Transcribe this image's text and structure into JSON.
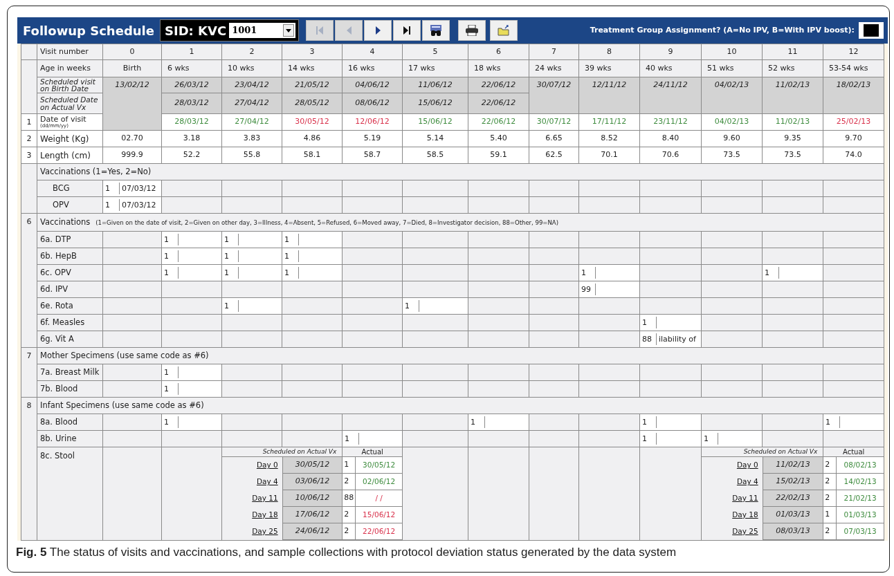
{
  "header": {
    "title": "Followup Schedule",
    "sid_label": "SID: KVC",
    "sid_value": "1001",
    "treatment_label": "Treatment Group Assignment? (A=No IPV, B=With IPV boost):"
  },
  "nav_buttons": [
    {
      "kind": "first",
      "disabled": true
    },
    {
      "kind": "prev",
      "disabled": true
    },
    {
      "kind": "next",
      "disabled": false
    },
    {
      "kind": "last",
      "disabled": false
    },
    {
      "kind": "find",
      "disabled": false
    },
    {
      "kind": "print",
      "disabled": false
    },
    {
      "kind": "open",
      "disabled": false
    }
  ],
  "row_labels": {
    "visit_number": "Visit number",
    "age": "Age in weeks",
    "scheduled_birth": "Scheduled visit on Birth Date",
    "scheduled_actual": "Scheduled Date on Actual Vx",
    "date": {
      "number": "1",
      "label": "Date of visit",
      "hint": "(dd/mm/yy)"
    },
    "weight": {
      "number": "2",
      "label": "Weight (Kg)"
    },
    "length": {
      "number": "3",
      "label": "Length (cm)"
    }
  },
  "visits": [
    {
      "number": "0",
      "age": "Birth",
      "scheduled_birth": "13/02/12",
      "weight": "02.70",
      "length": "999.9"
    },
    {
      "number": "1",
      "age": "6 wks",
      "scheduled_birth": "26/03/12",
      "scheduled_actual": "28/03/12",
      "date": "28/03/12",
      "on_time": true,
      "weight": "3.18",
      "length": "52.2"
    },
    {
      "number": "2",
      "age": "10 wks",
      "scheduled_birth": "23/04/12",
      "scheduled_actual": "27/04/12",
      "date": "27/04/12",
      "on_time": true,
      "weight": "3.83",
      "length": "55.8"
    },
    {
      "number": "3",
      "age": "14 wks",
      "scheduled_birth": "21/05/12",
      "scheduled_actual": "28/05/12",
      "date": "30/05/12",
      "on_time": false,
      "weight": "4.86",
      "length": "58.1"
    },
    {
      "number": "4",
      "age": "16 wks",
      "scheduled_birth": "04/06/12",
      "scheduled_actual": "08/06/12",
      "date": "12/06/12",
      "on_time": false,
      "weight": "5.19",
      "length": "58.7"
    },
    {
      "number": "5",
      "age": "17 wks",
      "scheduled_birth": "11/06/12",
      "scheduled_actual": "15/06/12",
      "date": "15/06/12",
      "on_time": true,
      "weight": "5.14",
      "length": "58.5"
    },
    {
      "number": "6",
      "age": "18 wks",
      "scheduled_birth": "22/06/12",
      "scheduled_actual": "22/06/12",
      "date": "22/06/12",
      "on_time": true,
      "weight": "5.40",
      "length": "59.1"
    },
    {
      "number": "7",
      "age": "24 wks",
      "scheduled_birth": "30/07/12",
      "date": "30/07/12",
      "on_time": true,
      "weight": "6.65",
      "length": "62.5"
    },
    {
      "number": "8",
      "age": "39 wks",
      "scheduled_birth": "12/11/12",
      "date": "17/11/12",
      "on_time": true,
      "weight": "8.52",
      "length": "70.1"
    },
    {
      "number": "9",
      "age": "40 wks",
      "scheduled_birth": "24/11/12",
      "date": "23/11/12",
      "on_time": true,
      "weight": "8.40",
      "length": "70.6"
    },
    {
      "number": "10",
      "age": "51 wks",
      "scheduled_birth": "04/02/13",
      "date": "04/02/13",
      "on_time": true,
      "weight": "9.60",
      "length": "73.5"
    },
    {
      "number": "11",
      "age": "52 wks",
      "scheduled_birth": "11/02/13",
      "date": "11/02/13",
      "on_time": true,
      "weight": "9.35",
      "length": "73.5"
    },
    {
      "number": "12",
      "age": "53-54 wks",
      "scheduled_birth": "18/02/13",
      "date": "25/02/13",
      "on_time": false,
      "weight": "9.70",
      "length": "74.0"
    }
  ],
  "sections": [
    {
      "title": "Vaccinations (1=Yes, 2=No)",
      "rows": [
        {
          "kind": "entries",
          "label": "BCG",
          "cells": [
            {
              "code": "1",
              "note": "07/03/12"
            },
            {},
            {},
            {},
            {},
            {},
            {},
            {},
            {},
            {},
            {},
            {},
            {}
          ]
        },
        {
          "kind": "entries",
          "label": "OPV",
          "cells": [
            {
              "code": "1",
              "note": "07/03/12"
            },
            {},
            {},
            {},
            {},
            {},
            {},
            {},
            {},
            {},
            {},
            {},
            {}
          ]
        }
      ]
    },
    {
      "number": "6",
      "title": "Vaccinations",
      "legend": "(1=Given on the date of visit, 2=Given on other day, 3=Illness, 4=Absent, 5=Refused, 6=Moved away, 7=Died, 8=Investigator decision, 88=Other, 99=NA)",
      "rows": [
        {
          "kind": "entries",
          "label": "6a. DTP",
          "cells": [
            {},
            {
              "code": "1"
            },
            {
              "code": "1"
            },
            {
              "code": "1"
            },
            {},
            {},
            {},
            {},
            {},
            {},
            {},
            {},
            {}
          ]
        },
        {
          "kind": "entries",
          "label": "6b. HepB",
          "cells": [
            {},
            {
              "code": "1"
            },
            {
              "code": "1"
            },
            {
              "code": "1"
            },
            {},
            {},
            {},
            {},
            {},
            {},
            {},
            {},
            {}
          ]
        },
        {
          "kind": "entries",
          "label": "6c. OPV",
          "cells": [
            {},
            {
              "code": "1"
            },
            {
              "code": "1"
            },
            {
              "code": "1"
            },
            {},
            {},
            {},
            {},
            {
              "code": "1"
            },
            {},
            {},
            {
              "code": "1"
            },
            {}
          ]
        },
        {
          "kind": "entries",
          "label": "6d. IPV",
          "cells": [
            {},
            {},
            {},
            {},
            {},
            {},
            {},
            {},
            {
              "code": "99"
            },
            {},
            {},
            {},
            {}
          ]
        },
        {
          "kind": "entries",
          "label": "6e. Rota",
          "cells": [
            {},
            {},
            {
              "code": "1"
            },
            {},
            {},
            {
              "code": "1"
            },
            {},
            {},
            {},
            {},
            {},
            {},
            {}
          ]
        },
        {
          "kind": "entries",
          "label": "6f. Measles",
          "cells": [
            {},
            {},
            {},
            {},
            {},
            {},
            {},
            {},
            {},
            {
              "code": "1"
            },
            {},
            {},
            {}
          ]
        },
        {
          "kind": "entries",
          "label": "6g. Vit A",
          "cells": [
            {},
            {},
            {},
            {},
            {},
            {},
            {},
            {},
            {},
            {
              "code": "88",
              "note": "ilability of"
            },
            {},
            {},
            {}
          ]
        }
      ]
    },
    {
      "number": "7",
      "title": "Mother Specimens (use same code as #6)",
      "rows": [
        {
          "kind": "entries",
          "label": "7a. Breast Milk",
          "cells": [
            {},
            {
              "code": "1"
            },
            {},
            {},
            {},
            {},
            {},
            {},
            {},
            {},
            {},
            {},
            {}
          ]
        },
        {
          "kind": "entries",
          "label": "7b. Blood",
          "cells": [
            {},
            {
              "code": "1"
            },
            {},
            {},
            {},
            {},
            {},
            {},
            {},
            {},
            {},
            {},
            {}
          ]
        }
      ]
    },
    {
      "number": "8",
      "title": "Infant Specimens (use same code as #6)",
      "rows": [
        {
          "kind": "entries",
          "label": "8a. Blood",
          "cells": [
            {},
            {
              "code": "1"
            },
            {},
            {},
            {},
            {},
            {
              "code": "1"
            },
            {},
            {},
            {
              "code": "1"
            },
            {},
            {},
            {
              "code": "1"
            }
          ]
        },
        {
          "kind": "entries",
          "label": "8b. Urine",
          "cells": [
            {},
            {},
            {},
            {},
            {
              "code": "1"
            },
            {},
            {},
            {},
            {},
            {
              "code": "1"
            },
            {
              "code": "1"
            },
            {},
            {}
          ]
        },
        {
          "kind": "schedule",
          "label": "8c. Stool",
          "blocks": [
            {
              "kind": "empty"
            },
            {
              "kind": "empty"
            },
            {
              "kind": "schedule",
              "heading": "Scheduled on Actual Vx",
              "actual_heading": "Actual",
              "days": [
                {
                  "label": "Day 0",
                  "scheduled": "30/05/12",
                  "code": "1",
                  "actual": "30/05/12",
                  "on_time": true
                },
                {
                  "label": "Day 4",
                  "scheduled": "03/06/12",
                  "code": "2",
                  "actual": "02/06/12",
                  "on_time": true
                },
                {
                  "label": "Day 11",
                  "scheduled": "10/06/12",
                  "code": "88",
                  "actual": "/ /",
                  "on_time": false
                },
                {
                  "label": "Day 18",
                  "scheduled": "17/06/12",
                  "code": "2",
                  "actual": "15/06/12",
                  "on_time": false
                },
                {
                  "label": "Day 25",
                  "scheduled": "24/06/12",
                  "code": "2",
                  "actual": "22/06/12",
                  "on_time": false
                }
              ]
            },
            {
              "kind": "empty"
            },
            {
              "kind": "empty"
            },
            {
              "kind": "empty"
            },
            {
              "kind": "empty"
            },
            {
              "kind": "empty"
            },
            {
              "kind": "schedule",
              "heading": "Scheduled on Actual Vx",
              "actual_heading": "Actual",
              "days": [
                {
                  "label": "Day 0",
                  "scheduled": "11/02/13",
                  "code": "2",
                  "actual": "08/02/13",
                  "on_time": true
                },
                {
                  "label": "Day 4",
                  "scheduled": "15/02/13",
                  "code": "2",
                  "actual": "14/02/13",
                  "on_time": true
                },
                {
                  "label": "Day 11",
                  "scheduled": "22/02/13",
                  "code": "2",
                  "actual": "21/02/13",
                  "on_time": true
                },
                {
                  "label": "Day 18",
                  "scheduled": "01/03/13",
                  "code": "1",
                  "actual": "01/03/13",
                  "on_time": true
                },
                {
                  "label": "Day 25",
                  "scheduled": "08/03/13",
                  "code": "2",
                  "actual": "07/03/13",
                  "on_time": true
                }
              ]
            }
          ]
        }
      ]
    }
  ],
  "caption": "**Fig. 5**  The status of visits and vaccinations, and sample collections with protocol deviation status generated by the data system"
}
